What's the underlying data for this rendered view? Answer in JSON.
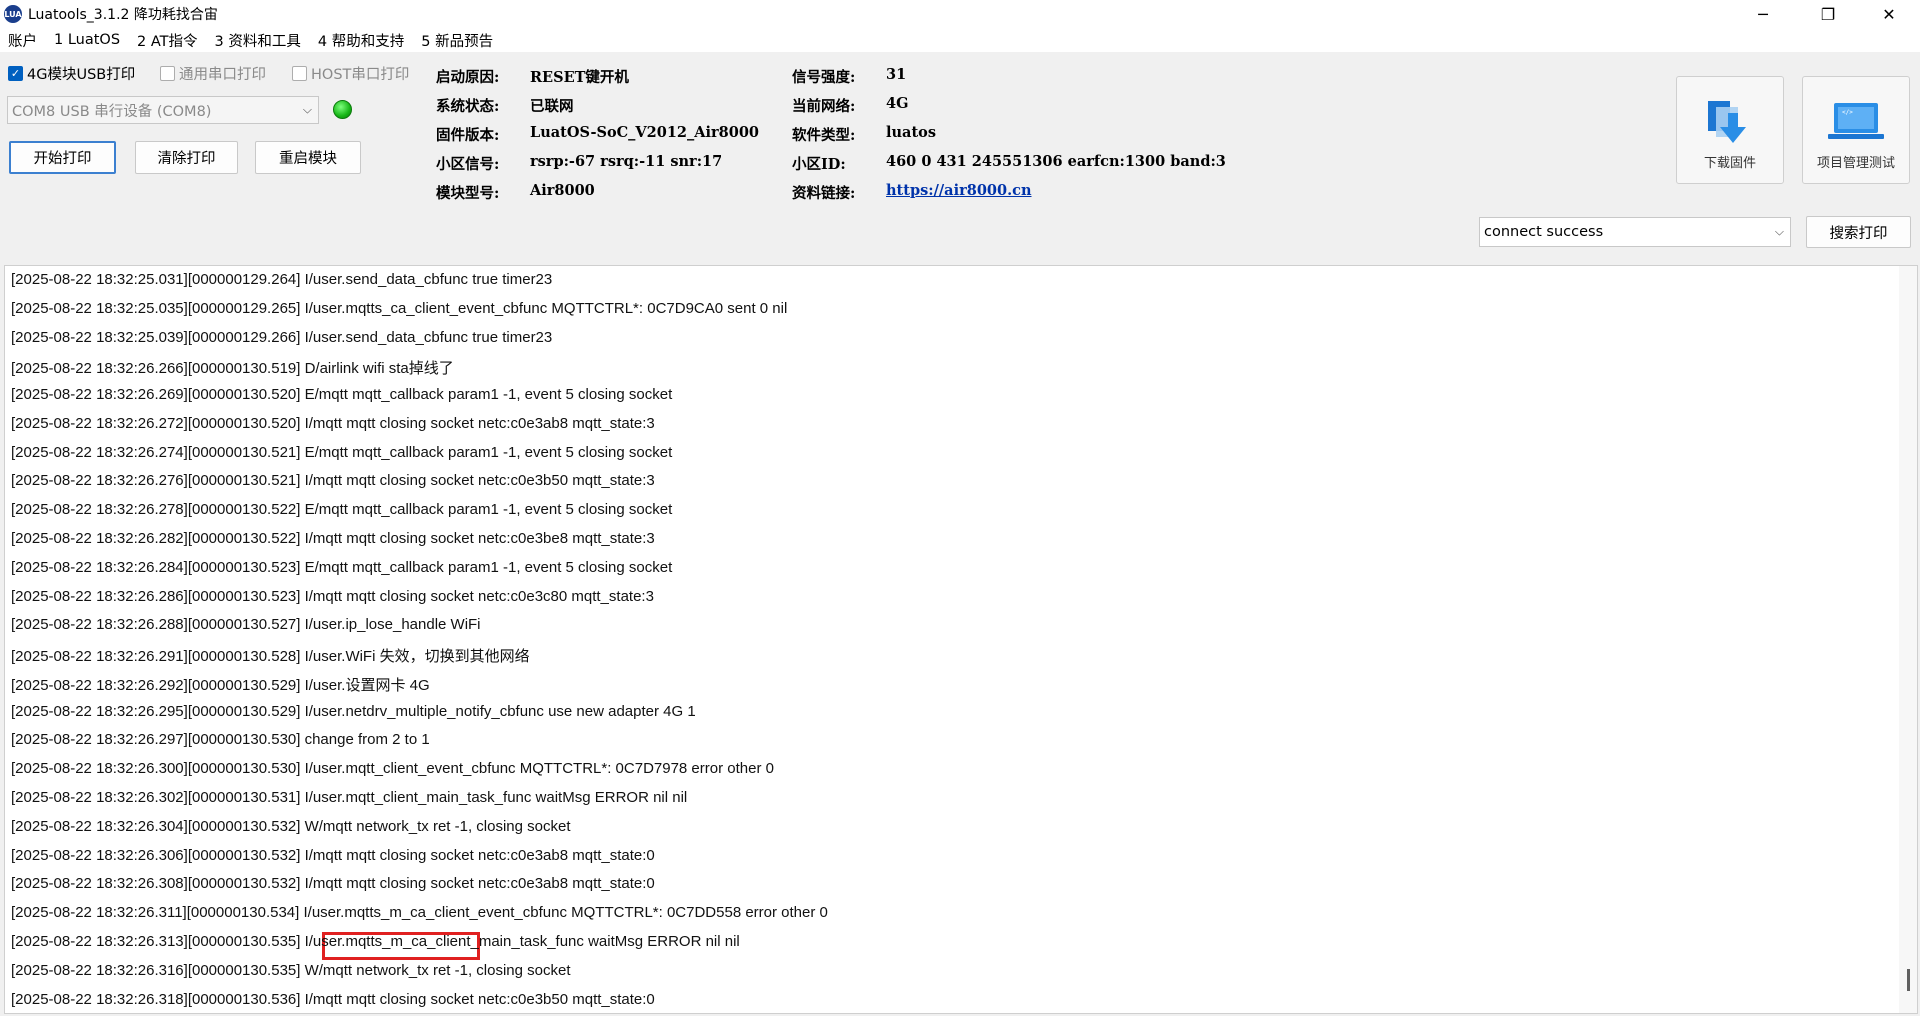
{
  "window": {
    "title": "Luatools_3.1.2 降功耗找合宙",
    "icon_text": "LUA",
    "controls": {
      "minimize": "─",
      "restore": "❐",
      "close": "✕"
    }
  },
  "menu": [
    "账户",
    "1 LuatOS",
    "2 AT指令",
    "3 资料和工具",
    "4 帮助和支持",
    "5 新品预告"
  ],
  "options": {
    "usb_print": {
      "label": "4G模块USB打印",
      "checked": true
    },
    "serial_print": {
      "label": "通用串口打印",
      "checked": false
    },
    "host_print": {
      "label": "HOST串口打印",
      "checked": false
    }
  },
  "port_select": {
    "value": "COM8 USB 串行设备 (COM8)"
  },
  "buttons": {
    "start": "开始打印",
    "clear": "清除打印",
    "restart": "重启模块"
  },
  "info_left": [
    {
      "label": "启动原因:",
      "value": "RESET键开机"
    },
    {
      "label": "系统状态:",
      "value": "已联网"
    },
    {
      "label": "固件版本:",
      "value": "LuatOS-SoC_V2012_Air8000"
    },
    {
      "label": "小区信号:",
      "value": "rsrp:-67 rsrq:-11 snr:17"
    },
    {
      "label": "模块型号:",
      "value": "Air8000"
    }
  ],
  "info_right": [
    {
      "label": "信号强度:",
      "value": "31"
    },
    {
      "label": "当前网络:",
      "value": "4G"
    },
    {
      "label": "软件类型:",
      "value": "luatos"
    },
    {
      "label": "小区ID:",
      "value": "460 0 431 245551306 earfcn:1300 band:3"
    },
    {
      "label": "资料链接:",
      "value": "https://air8000.cn"
    }
  ],
  "tools": {
    "download": "下载固件",
    "project": "项目管理测试"
  },
  "search": {
    "value": "connect success",
    "button": "搜索打印"
  },
  "log_lines": [
    "[2025-08-22 18:32:25.031][000000129.264] I/user.send_data_cbfunc true timer23",
    "[2025-08-22 18:32:25.035][000000129.265] I/user.mqtts_ca_client_event_cbfunc MQTTCTRL*: 0C7D9CA0 sent 0 nil",
    "[2025-08-22 18:32:25.039][000000129.266] I/user.send_data_cbfunc true timer23",
    "[2025-08-22 18:32:26.266][000000130.519] D/airlink wifi sta掉线了",
    "[2025-08-22 18:32:26.269][000000130.520] E/mqtt mqtt_callback param1 -1, event 5 closing socket",
    "[2025-08-22 18:32:26.272][000000130.520] I/mqtt mqtt closing socket netc:c0e3ab8 mqtt_state:3",
    "[2025-08-22 18:32:26.274][000000130.521] E/mqtt mqtt_callback param1 -1, event 5 closing socket",
    "[2025-08-22 18:32:26.276][000000130.521] I/mqtt mqtt closing socket netc:c0e3b50 mqtt_state:3",
    "[2025-08-22 18:32:26.278][000000130.522] E/mqtt mqtt_callback param1 -1, event 5 closing socket",
    "[2025-08-22 18:32:26.282][000000130.522] I/mqtt mqtt closing socket netc:c0e3be8 mqtt_state:3",
    "[2025-08-22 18:32:26.284][000000130.523] E/mqtt mqtt_callback param1 -1, event 5 closing socket",
    "[2025-08-22 18:32:26.286][000000130.523] I/mqtt mqtt closing socket netc:c0e3c80 mqtt_state:3",
    "[2025-08-22 18:32:26.288][000000130.527] I/user.ip_lose_handle WiFi",
    "[2025-08-22 18:32:26.291][000000130.528] I/user.WiFi 失效，切换到其他网络",
    "[2025-08-22 18:32:26.292][000000130.529] I/user.设置网卡 4G",
    "[2025-08-22 18:32:26.295][000000130.529] I/user.netdrv_multiple_notify_cbfunc use new adapter 4G 1",
    "[2025-08-22 18:32:26.297][000000130.530] change from 2 to 1",
    "[2025-08-22 18:32:26.300][000000130.530] I/user.mqtt_client_event_cbfunc MQTTCTRL*: 0C7D7978 error other 0",
    "[2025-08-22 18:32:26.302][000000130.531] I/user.mqtt_client_main_task_func waitMsg ERROR nil nil",
    "[2025-08-22 18:32:26.304][000000130.532] W/mqtt network_tx ret -1, closing socket",
    "[2025-08-22 18:32:26.306][000000130.532] I/mqtt mqtt closing socket netc:c0e3ab8 mqtt_state:0",
    "[2025-08-22 18:32:26.308][000000130.532] I/mqtt mqtt closing socket netc:c0e3ab8 mqtt_state:0",
    "[2025-08-22 18:32:26.311][000000130.534] I/user.mqtts_m_ca_client_event_cbfunc MQTTCTRL*: 0C7DD558 error other 0",
    "[2025-08-22 18:32:26.313][000000130.535] I/user.mqtts_m_ca_client_main_task_func waitMsg ERROR nil nil",
    "[2025-08-22 18:32:26.316][000000130.535] W/mqtt network_tx ret -1, closing socket",
    "[2025-08-22 18:32:26.318][000000130.536] I/mqtt mqtt closing socket netc:c0e3b50 mqtt_state:0"
  ],
  "highlight_line_index": 14
}
